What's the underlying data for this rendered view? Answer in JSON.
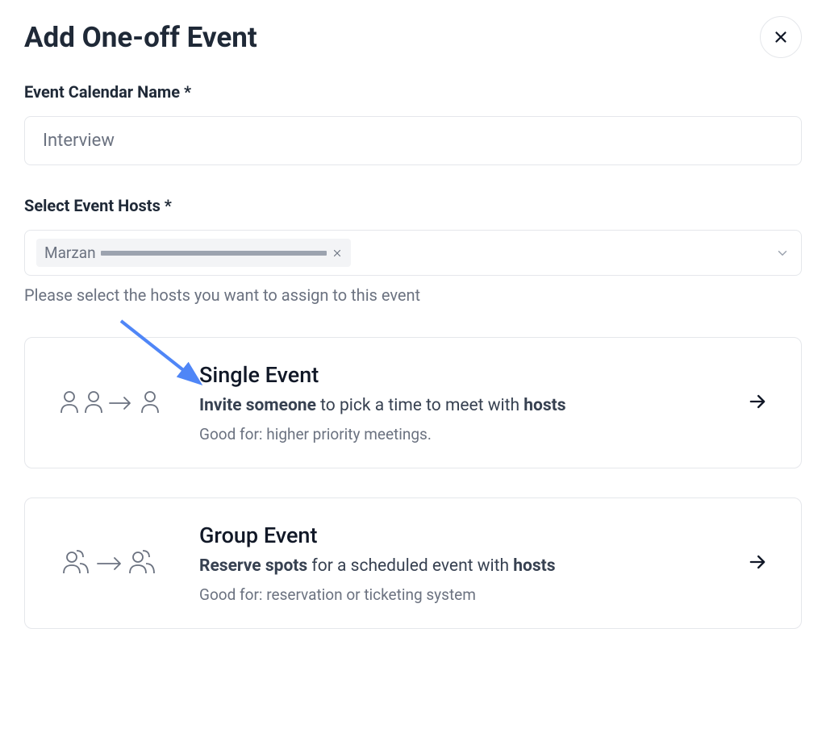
{
  "modal": {
    "title": "Add One-off Event"
  },
  "fields": {
    "eventName": {
      "label": "Event Calendar Name *",
      "value": "Interview"
    },
    "hosts": {
      "label": "Select Event Hosts *",
      "selectedName": "Marzan",
      "helper": "Please select the hosts you want to assign to this event"
    }
  },
  "options": {
    "single": {
      "title": "Single Event",
      "desc_bold1": "Invite someone",
      "desc_mid": " to pick a time to meet with ",
      "desc_bold2": "hosts",
      "sub": "Good for: higher priority meetings."
    },
    "group": {
      "title": "Group Event",
      "desc_bold1": "Reserve spots",
      "desc_mid": " for a scheduled event with ",
      "desc_bold2": "hosts",
      "sub": "Good for: reservation or ticketing system"
    }
  }
}
